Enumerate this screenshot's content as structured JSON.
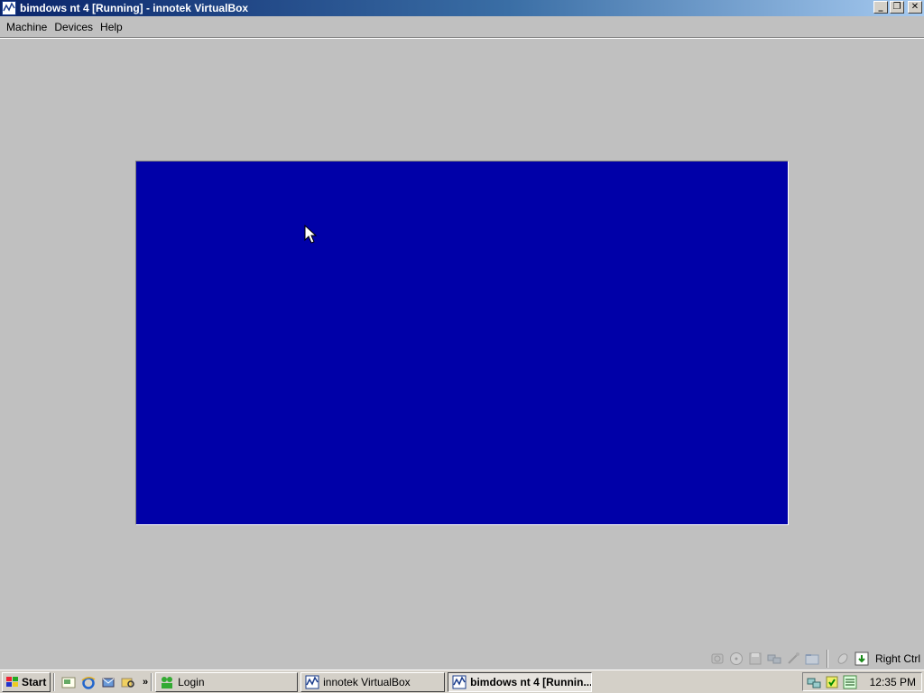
{
  "window": {
    "title": "bimdows nt 4 [Running] - innotek VirtualBox",
    "buttons": {
      "minimize": "_",
      "restore": "❐",
      "close": "✕"
    }
  },
  "menu": [
    "Machine",
    "Devices",
    "Help"
  ],
  "guest": {
    "background_color": "#0000a8"
  },
  "statusbar": {
    "icons": [
      "hard-disk-icon",
      "cd-rom-icon",
      "floppy-icon",
      "network-icon",
      "usb-icon",
      "shared-folders-icon",
      "mouse-integration-icon",
      "host-key-arrow-icon"
    ],
    "host_key": "Right Ctrl"
  },
  "taskbar": {
    "start_label": "Start",
    "quick_launch": [
      "show-desktop-icon",
      "internet-explorer-icon",
      "outlook-express-icon",
      "windows-explorer-icon"
    ],
    "more": "»",
    "tasks": [
      {
        "label": "Login",
        "icon": "login-app-icon",
        "active": false
      },
      {
        "label": "innotek VirtualBox",
        "icon": "virtualbox-icon",
        "active": false
      },
      {
        "label": "bimdows nt 4 [Runnin...",
        "icon": "virtualbox-icon",
        "active": true
      }
    ],
    "tray_icons": [
      "network-tray-icon",
      "security-tray-icon",
      "eco-pro-tray-icon"
    ],
    "clock": "12:35 PM"
  }
}
